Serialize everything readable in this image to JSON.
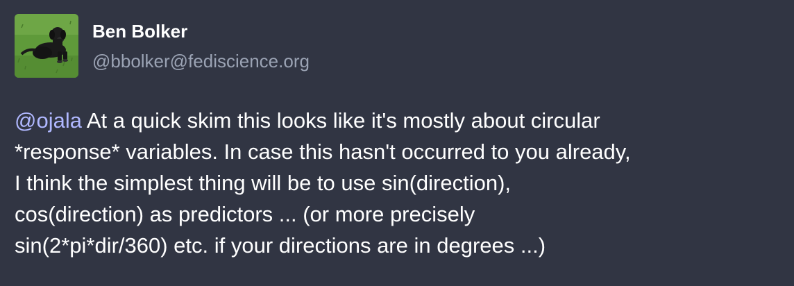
{
  "author": {
    "display_name": "Ben Bolker",
    "handle": "@bbolker@fediscience.org",
    "avatar_icon": "dog-photo-avatar"
  },
  "post": {
    "mention": "@ojala",
    "lines": [
      " At a quick skim this looks like it's mostly about circular",
      "*response* variables. In case this hasn't occurred to you already,",
      "I think the simplest thing will be to use sin(direction),",
      "cos(direction) as predictors ... (or more precisely",
      "sin(2*pi*dir/360) etc. if your directions are in degrees ...)"
    ]
  },
  "colors": {
    "background": "#313543",
    "mention": "#b0b8ff",
    "handle": "#9ba3b4"
  }
}
